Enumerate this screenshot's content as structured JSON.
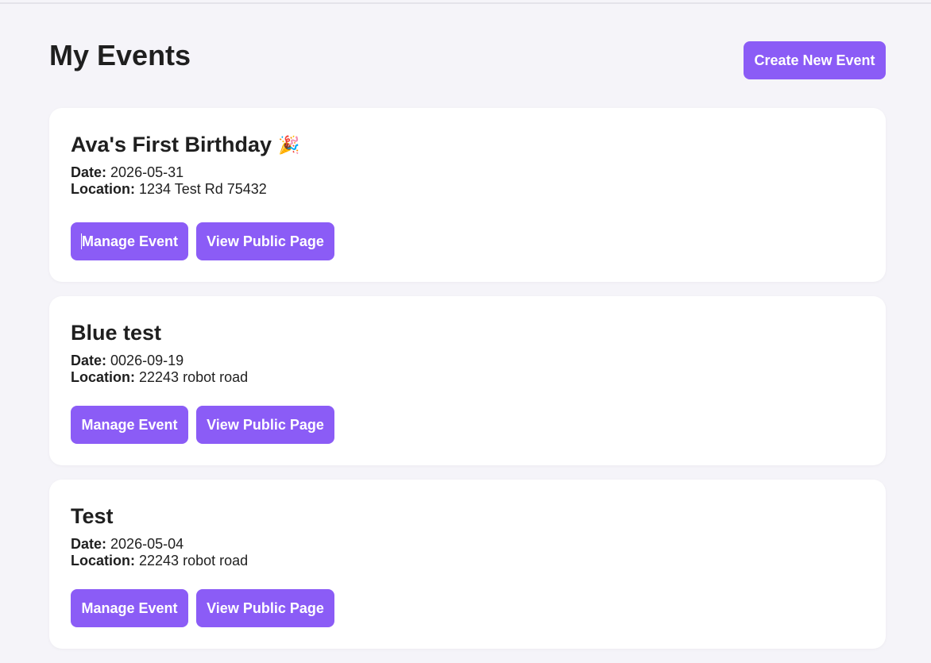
{
  "header": {
    "title": "My Events",
    "create_button": "Create New Event"
  },
  "labels": {
    "date": "Date:",
    "location": "Location:",
    "manage": "Manage Event",
    "view_public": "View Public Page"
  },
  "events": [
    {
      "title": "Ava's First Birthday",
      "icon": "party-popper-icon",
      "date": "2026-05-31",
      "location": "1234 Test Rd 75432"
    },
    {
      "title": "Blue test",
      "date": "0026-09-19",
      "location": "22243 robot road"
    },
    {
      "title": "Test",
      "date": "2026-05-04",
      "location": "22243 robot road"
    }
  ],
  "colors": {
    "accent": "#8b5cf6",
    "background": "#f5f4f9",
    "card": "#ffffff"
  }
}
